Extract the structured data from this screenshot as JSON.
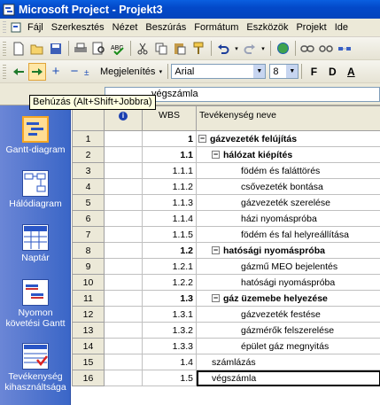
{
  "window": {
    "title": "Microsoft Project - Projekt3"
  },
  "menu": [
    "Fájl",
    "Szerkesztés",
    "Nézet",
    "Beszúrás",
    "Formátum",
    "Eszközök",
    "Projekt",
    "Ide"
  ],
  "toolbar2": {
    "display_label": "Megjelenítés",
    "font_name": "Arial",
    "font_size": "8",
    "bold_label": "F",
    "italic_label": "D",
    "underline_label": "A"
  },
  "entry": {
    "value": "végszámla"
  },
  "tooltip": "Behúzás (Alt+Shift+Jobbra)",
  "viewbar": [
    {
      "label": "Gantt-diagram",
      "icon": "gantt-chart-icon",
      "active": true
    },
    {
      "label": "Hálódiagram",
      "icon": "network-diagram-icon"
    },
    {
      "label": "Naptár",
      "icon": "calendar-icon"
    },
    {
      "label": "Nyomon követési Gantt",
      "icon": "tracking-gantt-icon"
    },
    {
      "label": "Tevékenység kihasználtsága",
      "icon": "task-usage-icon"
    }
  ],
  "table": {
    "columns": [
      "",
      "i",
      "WBS",
      "Tevékenység neve"
    ],
    "rows": [
      {
        "id": "1",
        "wbs": "1",
        "name": "gázvezeték felújítás",
        "level": 0,
        "summary": true
      },
      {
        "id": "2",
        "wbs": "1.1",
        "name": "hálózat kiépítés",
        "level": 1,
        "summary": true
      },
      {
        "id": "3",
        "wbs": "1.1.1",
        "name": "födém és faláttörés",
        "level": 2,
        "summary": false
      },
      {
        "id": "4",
        "wbs": "1.1.2",
        "name": "csővezeték bontása",
        "level": 2,
        "summary": false
      },
      {
        "id": "5",
        "wbs": "1.1.3",
        "name": "gázvezeték szerelése",
        "level": 2,
        "summary": false
      },
      {
        "id": "6",
        "wbs": "1.1.4",
        "name": "házi nyomáspróba",
        "level": 2,
        "summary": false
      },
      {
        "id": "7",
        "wbs": "1.1.5",
        "name": "födém és fal helyreállítása",
        "level": 2,
        "summary": false
      },
      {
        "id": "8",
        "wbs": "1.2",
        "name": "hatósági nyomáspróba",
        "level": 1,
        "summary": true
      },
      {
        "id": "9",
        "wbs": "1.2.1",
        "name": "gázmű MEO bejelentés",
        "level": 2,
        "summary": false
      },
      {
        "id": "10",
        "wbs": "1.2.2",
        "name": "hatósági nyomáspróba",
        "level": 2,
        "summary": false
      },
      {
        "id": "11",
        "wbs": "1.3",
        "name": "gáz üzemebe helyezése",
        "level": 1,
        "summary": true
      },
      {
        "id": "12",
        "wbs": "1.3.1",
        "name": "gázvezeték festése",
        "level": 2,
        "summary": false
      },
      {
        "id": "13",
        "wbs": "1.3.2",
        "name": "gázmérők felszerelése",
        "level": 2,
        "summary": false
      },
      {
        "id": "14",
        "wbs": "1.3.3",
        "name": "épület gáz megnyitás",
        "level": 2,
        "summary": false
      },
      {
        "id": "15",
        "wbs": "1.4",
        "name": "számlázás",
        "level": 1,
        "summary": false
      },
      {
        "id": "16",
        "wbs": "1.5",
        "name": "végszámla",
        "level": 1,
        "summary": false,
        "selected": true
      }
    ]
  }
}
